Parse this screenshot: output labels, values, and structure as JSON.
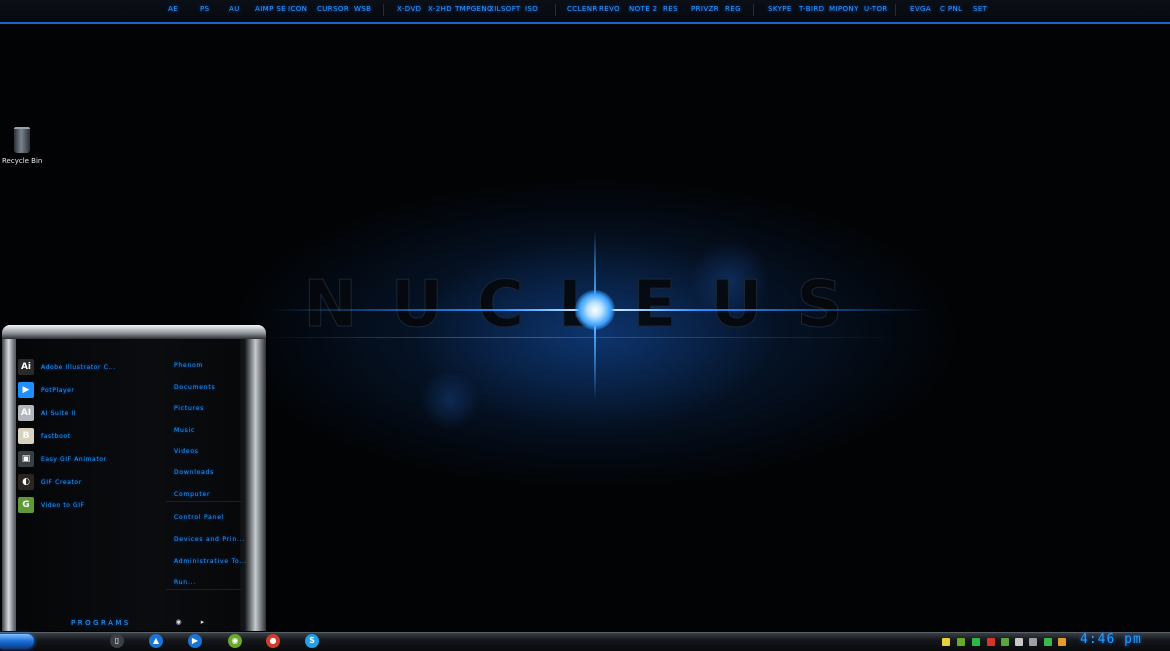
{
  "topbar": {
    "items": [
      "AE",
      "PS",
      "AU",
      "AIMP SE",
      "ICON",
      "CURSOR",
      "WSB",
      "X-DVD",
      "X-2HD",
      "TMPGENC",
      "XILSOFT",
      "ISO",
      "CCLENR",
      "REVO",
      "NOTE 2",
      "RES",
      "PRIVZR",
      "REG",
      "SKYPE",
      "T-BIRD",
      "MIPONY",
      "U-TOR",
      "EVGA",
      "C PNL",
      "SET"
    ]
  },
  "desktop": {
    "recycle_bin_label": "Recycle Bin",
    "wallpaper_text": "NUCLEUS"
  },
  "start_menu": {
    "programs": [
      {
        "label": "Adobe Illustrator C...",
        "icon": "adobe-illustrator-icon",
        "glyph": "Ai",
        "color": "#2a2a2a"
      },
      {
        "label": "PotPlayer",
        "icon": "potplayer-icon",
        "glyph": "▶",
        "color": "#1f8fff"
      },
      {
        "label": "AI Suite II",
        "icon": "ai-suite-icon",
        "glyph": "AI",
        "color": "#b0b6bc"
      },
      {
        "label": "fastboot",
        "icon": "fastboot-icon",
        "glyph": "B",
        "color": "#d8d2bf"
      },
      {
        "label": "Easy GIF Animator",
        "icon": "gif-animator-icon",
        "glyph": "▣",
        "color": "#3a3f44"
      },
      {
        "label": "GIF Creator",
        "icon": "gif-creator-icon",
        "glyph": "◐",
        "color": "#2a2520"
      },
      {
        "label": "Video to GIF",
        "icon": "video-to-gif-icon",
        "glyph": "G",
        "color": "#5f9a3a"
      }
    ],
    "places": [
      "Phenom",
      "Documents",
      "Pictures",
      "Music",
      "Videos",
      "Downloads",
      "Computer",
      "Control Panel",
      "Devices and Prin...",
      "Administrative To...",
      "Run..."
    ],
    "programs_label": "PROGRAMS"
  },
  "taskbar": {
    "clock": "4:46 pm",
    "apps": [
      {
        "name": "explorer-icon",
        "glyph": "▯",
        "color": "#3a3f45"
      },
      {
        "name": "aimp-icon",
        "glyph": "▲",
        "color": "#1a74d8"
      },
      {
        "name": "potplayer-icon",
        "glyph": "▶",
        "color": "#1a74d8"
      },
      {
        "name": "nvidia-icon",
        "glyph": "◉",
        "color": "#6aa82a"
      },
      {
        "name": "media-icon",
        "glyph": "●",
        "color": "#d23a2a"
      },
      {
        "name": "skype-icon",
        "glyph": "S",
        "color": "#1fa0e8"
      }
    ],
    "tray": [
      {
        "name": "tray-folder-icon",
        "color": "#e8d23a"
      },
      {
        "name": "tray-nvidia-icon",
        "color": "#6aa82a"
      },
      {
        "name": "tray-network-icon",
        "color": "#2ab84a"
      },
      {
        "name": "tray-alert-icon",
        "color": "#d8342a"
      },
      {
        "name": "tray-utorrent-icon",
        "color": "#5aa83a"
      },
      {
        "name": "tray-app-icon",
        "color": "#c8c8c8"
      },
      {
        "name": "tray-volume-icon",
        "color": "#9aa0a6"
      },
      {
        "name": "tray-signal-icon",
        "color": "#3ab84a"
      },
      {
        "name": "tray-battery-icon",
        "color": "#e89a2a"
      }
    ]
  },
  "colors": {
    "accent": "#1f9bff",
    "topbar_border": "#1a66c8"
  }
}
